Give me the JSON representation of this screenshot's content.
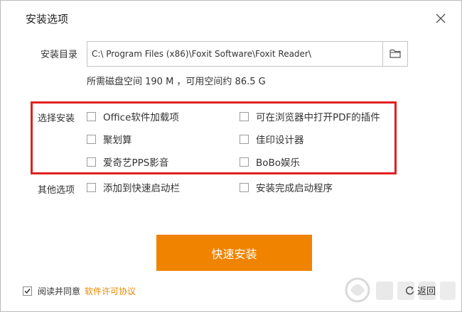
{
  "dialog": {
    "title": "安装选项",
    "close_icon": "close-icon"
  },
  "install_dir": {
    "label": "安装目录",
    "path": "C:\\ Program Files (x86)\\Foxit Software\\Foxit Reader\\",
    "browse_icon": "folder-icon"
  },
  "disk_space": {
    "text": "所需磁盘空间 190 M ，可用空间约 86.5 G"
  },
  "select_install": {
    "label": "选择安装",
    "highlight_color": "#e21f1f",
    "options": [
      {
        "label": "Office软件加载项",
        "checked": false
      },
      {
        "label": "可在浏览器中打开PDF的插件",
        "checked": false
      },
      {
        "label": "聚划算",
        "checked": false
      },
      {
        "label": "佳印设计器",
        "checked": false
      },
      {
        "label": "爱奇艺PPS影音",
        "checked": false
      },
      {
        "label": "BoBo娱乐",
        "checked": false
      }
    ]
  },
  "other_options": {
    "label": "其他选项",
    "options": [
      {
        "label": "添加到快速启动栏",
        "checked": false
      },
      {
        "label": "安装完成启动程序",
        "checked": false
      }
    ]
  },
  "install_button": {
    "label": "快速安装",
    "color": "#f08300"
  },
  "agreement": {
    "checked": true,
    "text": "阅读并同意",
    "link_text": "软件许可协议",
    "link_color": "#e58a00"
  },
  "back": {
    "label": "返回",
    "icon": "back-arrow-icon"
  }
}
